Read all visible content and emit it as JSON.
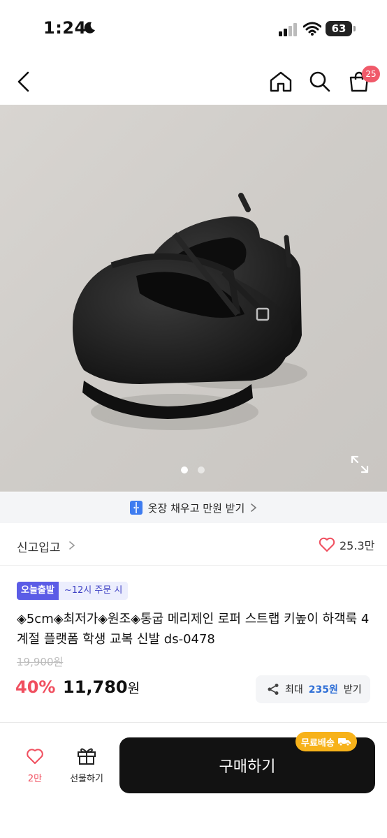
{
  "status_bar": {
    "time": "1:24",
    "battery": "63"
  },
  "nav": {
    "cart_count": "25"
  },
  "product": {
    "image_dots": {
      "active": 1,
      "total": 2
    }
  },
  "promo_banner": {
    "text": "옷장 채우고 만원 받기"
  },
  "shop": {
    "name": "신고입고",
    "like_count": "25.3만"
  },
  "tags": {
    "today": "오늘출발",
    "time": "~12시 주문 시"
  },
  "title": "◈5cm◈최저가◈원조◈통굽 메리제인 로퍼 스트랩 키높이 하객룩 4계절 플랫폼 학생 교복 신발 ds-0478",
  "price": {
    "original": "19,900원",
    "discount": "40%",
    "sale": "11,780",
    "sale_unit": "원"
  },
  "reward": {
    "prefix": "최대",
    "amount": "235원",
    "suffix": "받기"
  },
  "bottom": {
    "wish_label": "2만",
    "gift_label": "선물하기",
    "buy_label": "구매하기",
    "free_shipping": "무료배송"
  },
  "colors": {
    "accent_red": "#f04f5f",
    "purple": "#5b5ce6",
    "blue": "#2f6fd6",
    "ship_yellow": "#f7b21a"
  }
}
